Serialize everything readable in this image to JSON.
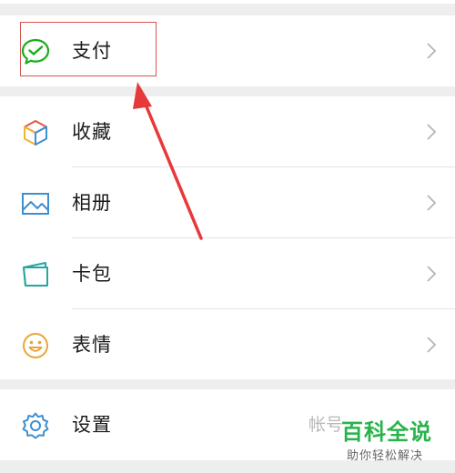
{
  "menu": {
    "payment": {
      "label": "支付",
      "icon": "wechat-pay-icon"
    },
    "favorites": {
      "label": "收藏",
      "icon": "favorites-cube-icon"
    },
    "album": {
      "label": "相册",
      "icon": "album-image-icon"
    },
    "cards": {
      "label": "卡包",
      "icon": "card-wallet-icon"
    },
    "stickers": {
      "label": "表情",
      "icon": "smiley-icon"
    },
    "settings": {
      "label": "设置",
      "icon": "gear-icon",
      "hint": "帐号"
    }
  },
  "watermark": {
    "title": "百科全说",
    "subtitle": "助你轻松解决"
  },
  "colors": {
    "pay_green": "#1aad19",
    "icon_blue": "#3d8fd1",
    "sticker_yellow": "#e9a53b",
    "highlight_red": "#d9534f",
    "background": "#eeeeee"
  }
}
